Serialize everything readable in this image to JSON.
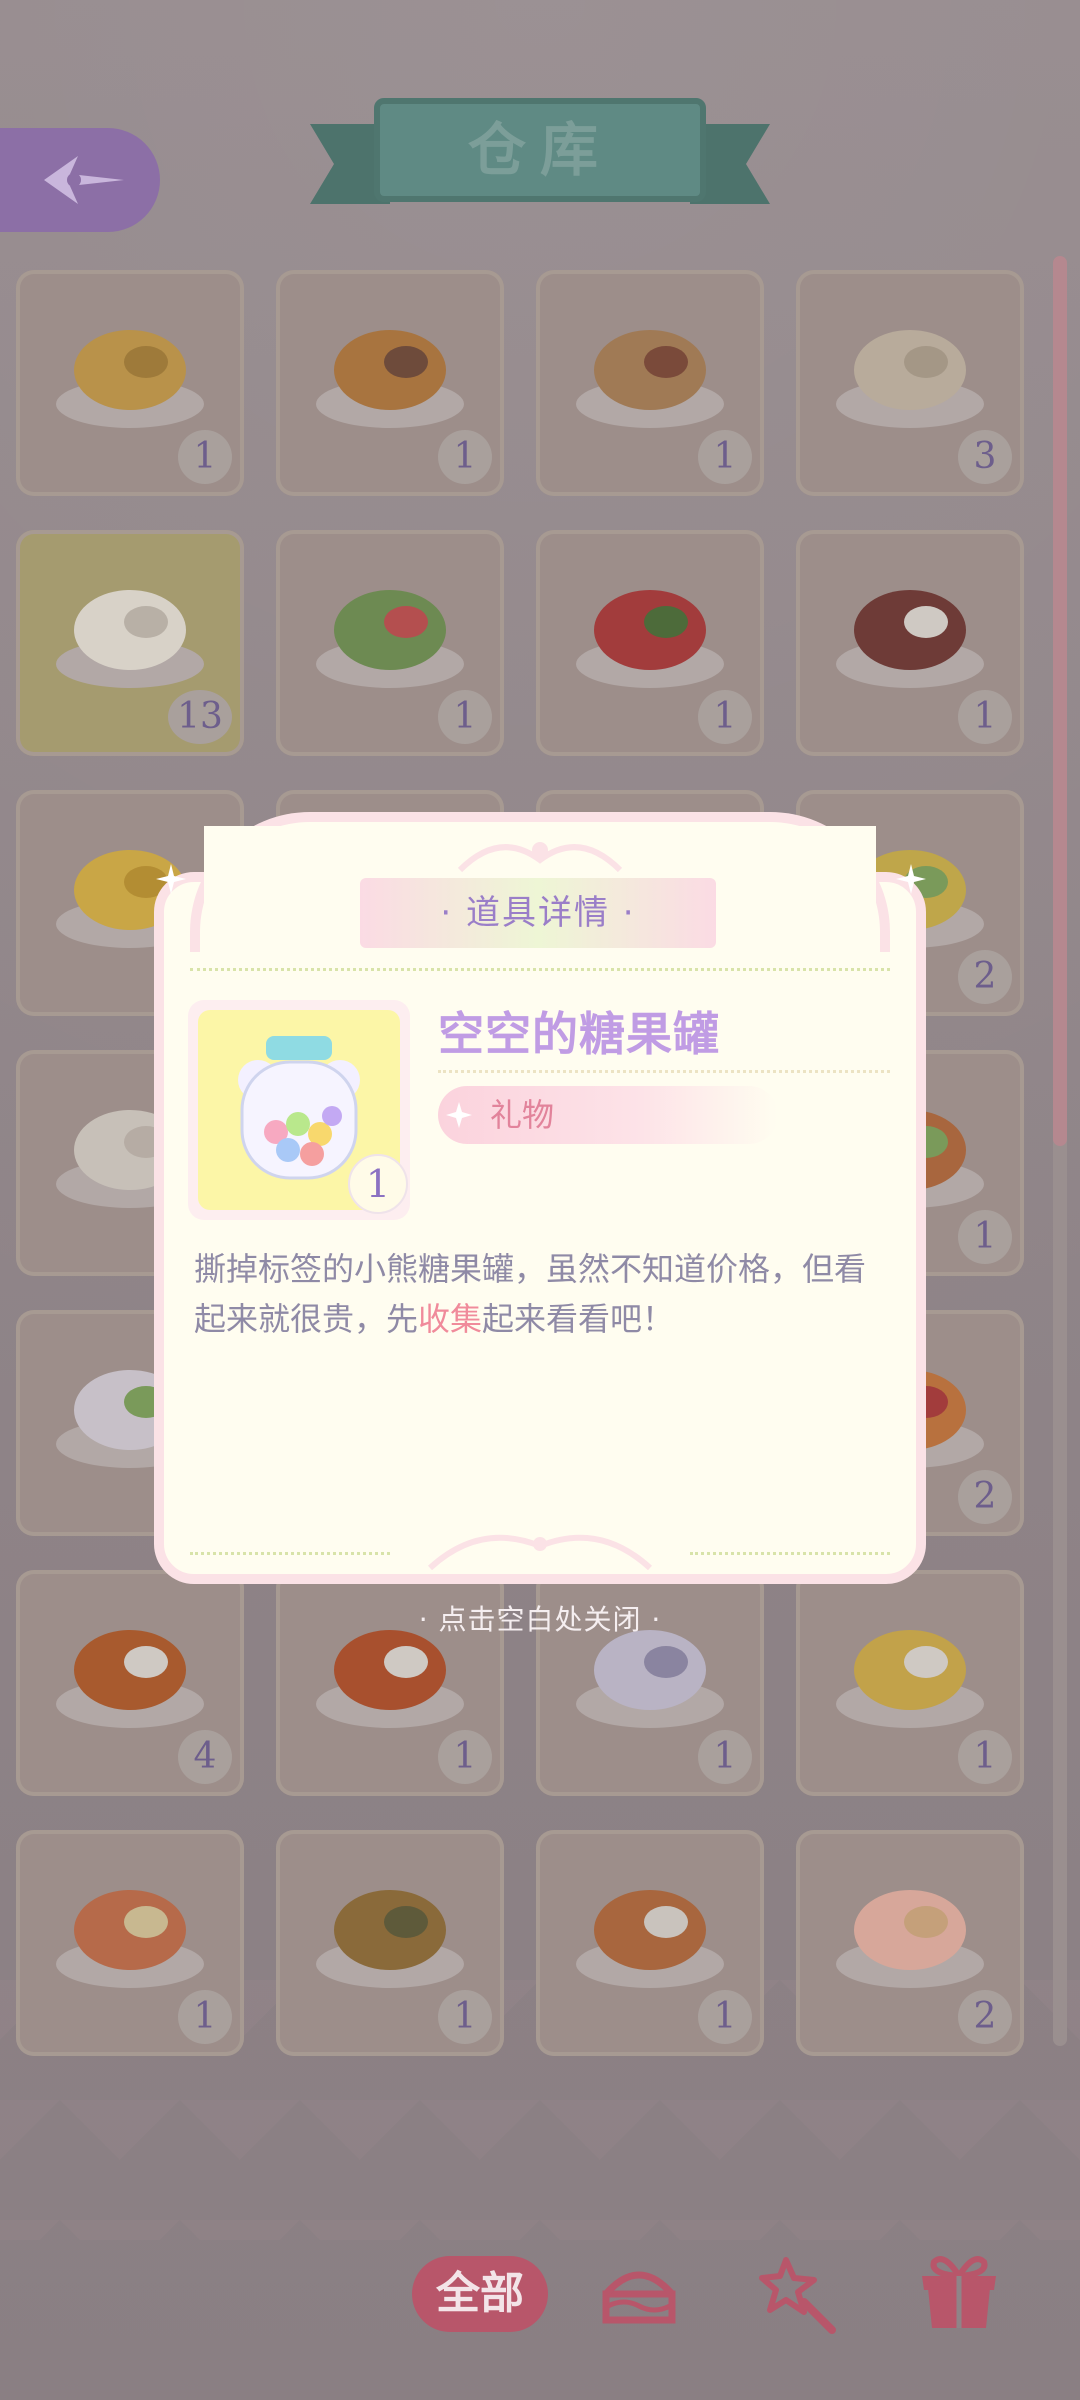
{
  "header": {
    "title": "仓库"
  },
  "inventory": {
    "items": [
      {
        "name": "bread-loaf",
        "count": "1"
      },
      {
        "name": "cake-slice",
        "count": "1"
      },
      {
        "name": "waffle-sandwich",
        "count": "1"
      },
      {
        "name": "flatbread",
        "count": "3"
      },
      {
        "name": "heart-rice-cake",
        "count": "13"
      },
      {
        "name": "salad",
        "count": "1"
      },
      {
        "name": "tomato-juice",
        "count": "1"
      },
      {
        "name": "meat-skewer",
        "count": "1"
      },
      {
        "name": "cheese",
        "count": ""
      },
      {
        "name": "hidden",
        "count": ""
      },
      {
        "name": "hidden",
        "count": ""
      },
      {
        "name": "egg-salad",
        "count": "2"
      },
      {
        "name": "eggs-bowl",
        "count": ""
      },
      {
        "name": "hidden",
        "count": ""
      },
      {
        "name": "hidden",
        "count": ""
      },
      {
        "name": "burger",
        "count": "1"
      },
      {
        "name": "jar",
        "count": ""
      },
      {
        "name": "hidden",
        "count": ""
      },
      {
        "name": "hidden",
        "count": ""
      },
      {
        "name": "pizza-slice",
        "count": "2"
      },
      {
        "name": "roast-chicken-leg",
        "count": "4"
      },
      {
        "name": "sausage-breakfast",
        "count": "1"
      },
      {
        "name": "ink-and-quill",
        "count": "1"
      },
      {
        "name": "egg-rolls",
        "count": "1"
      },
      {
        "name": "tomato-rolls",
        "count": "1"
      },
      {
        "name": "grilled-fish",
        "count": "1"
      },
      {
        "name": "hotdog",
        "count": "1"
      },
      {
        "name": "cream-puff",
        "count": "2"
      }
    ]
  },
  "dialog": {
    "title": "· 道具详情 ·",
    "item_name": "空空的糖果罐",
    "item_count": "1",
    "type": "礼物",
    "desc_before": "撕掉标签的小熊糖果罐，虽然不知道价格，但看起来就很贵，先",
    "desc_highlight": "收集",
    "desc_after": "起来看看吧！"
  },
  "close_hint": "· 点击空白处关闭 ·",
  "tabs": {
    "all": "全部"
  }
}
